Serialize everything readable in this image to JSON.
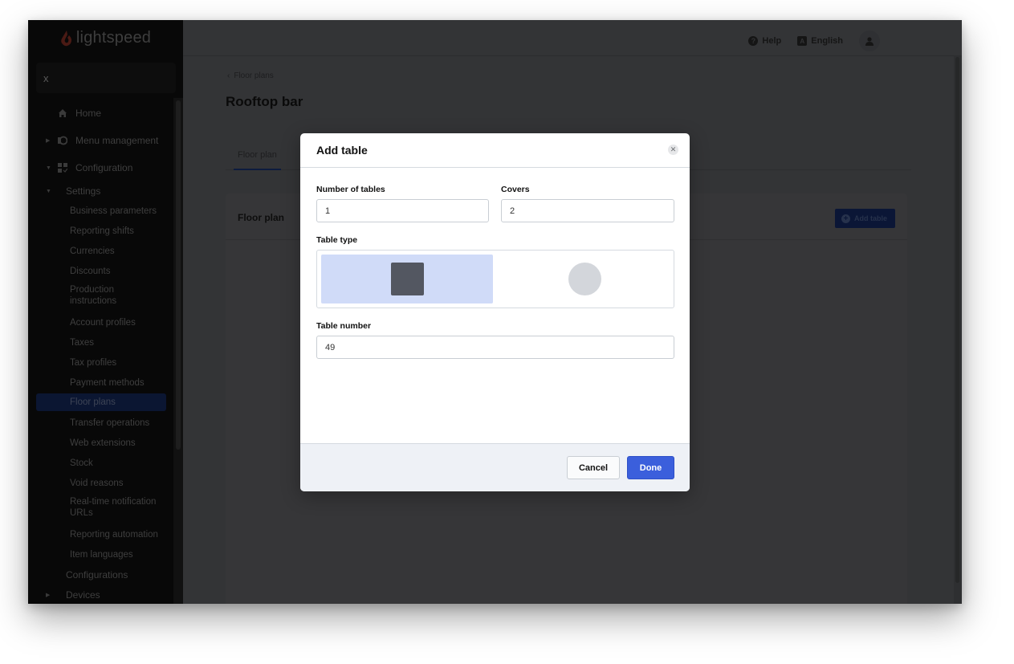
{
  "app": {
    "brand": "lightspeed",
    "brand_color": "#e8452c"
  },
  "sidebar": {
    "close_label": "x",
    "items": [
      {
        "label": "Home",
        "icon": "home-icon",
        "kind": "top"
      },
      {
        "label": "Menu management",
        "icon": "menu-management-icon",
        "kind": "top",
        "caret": "collapsed"
      },
      {
        "label": "Configuration",
        "icon": "configuration-icon",
        "kind": "top",
        "caret": "expanded"
      },
      {
        "label": "Settings",
        "kind": "group",
        "caret": "expanded"
      },
      {
        "label": "Business parameters",
        "kind": "sub"
      },
      {
        "label": "Reporting shifts",
        "kind": "sub"
      },
      {
        "label": "Currencies",
        "kind": "sub"
      },
      {
        "label": "Discounts",
        "kind": "sub"
      },
      {
        "label": "Production instructions",
        "kind": "sub"
      },
      {
        "label": "Account profiles",
        "kind": "sub"
      },
      {
        "label": "Taxes",
        "kind": "sub"
      },
      {
        "label": "Tax profiles",
        "kind": "sub"
      },
      {
        "label": "Payment methods",
        "kind": "sub"
      },
      {
        "label": "Floor plans",
        "kind": "sub",
        "active": true
      },
      {
        "label": "Transfer operations",
        "kind": "sub"
      },
      {
        "label": "Web extensions",
        "kind": "sub"
      },
      {
        "label": "Stock",
        "kind": "sub"
      },
      {
        "label": "Void reasons",
        "kind": "sub"
      },
      {
        "label": "Real-time notification URLs",
        "kind": "sub"
      },
      {
        "label": "Reporting automation",
        "kind": "sub"
      },
      {
        "label": "Item languages",
        "kind": "sub"
      },
      {
        "label": "Configurations",
        "kind": "group"
      },
      {
        "label": "Devices",
        "kind": "group",
        "caret": "collapsed"
      }
    ]
  },
  "topbar": {
    "help_label": "Help",
    "language_label": "English",
    "language_icon_letter": "A"
  },
  "page": {
    "breadcrumb": "Floor plans",
    "title": "Rooftop bar",
    "tabs": [
      {
        "label": "Floor plan",
        "active": true
      }
    ],
    "card": {
      "title": "Floor plan",
      "add_table_label": "Add table"
    }
  },
  "modal": {
    "title": "Add table",
    "number_of_tables": {
      "label": "Number of tables",
      "value": "1"
    },
    "covers": {
      "label": "Covers",
      "value": "2"
    },
    "table_type": {
      "label": "Table type",
      "options": [
        {
          "name": "square",
          "selected": true
        },
        {
          "name": "round",
          "selected": false
        }
      ]
    },
    "table_number": {
      "label": "Table number",
      "value": "49"
    },
    "cancel_label": "Cancel",
    "done_label": "Done",
    "accent_color": "#3b5fdc"
  }
}
